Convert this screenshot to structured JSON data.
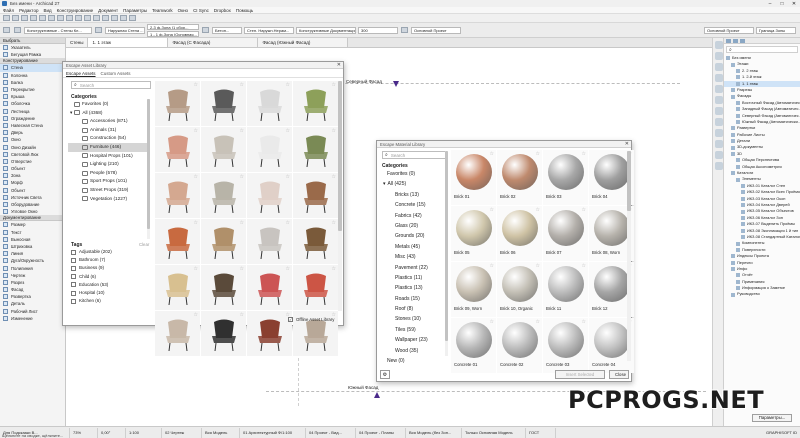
{
  "app": {
    "window_title": "Без имени - Archicad 27",
    "menu": [
      "Файл",
      "Редактор",
      "Вид",
      "Конструирование",
      "Документ",
      "Параметры",
      "Teamwork",
      "Окно",
      "CI Sync",
      "Dropbox",
      "Помощь"
    ]
  },
  "toolbar": {
    "field1": "Конструктивные - Стены Кл...",
    "field2": "Наружная Стена ...",
    "field3": "2-3 ф-Зона (1 сбор...",
    "field4": "1 - 1 ф-Зона (Основная...",
    "field5": "Бетон...",
    "field6": "Стен. Наружн.Нерам...",
    "field7": "Конструктивные Документации...",
    "field8": "300",
    "field9": "Основной Проект",
    "field10": "Основной Проект",
    "field11": "Граница Зоны"
  },
  "view_tabs": [
    "Стены",
    "1. 1 этаж",
    "Фасад (С Фасада)",
    "Фасад (Южный Фасад)"
  ],
  "left_panel": {
    "sections": [
      {
        "title": "Выбрать",
        "items": [
          "Указатель",
          "Бегущая Рамка"
        ]
      },
      {
        "title": "Конструирование",
        "items": [
          "Стена",
          "Колонна",
          "Балка",
          "Перекрытие",
          "Крыша",
          "Оболочка",
          "Лестница",
          "Ограждение",
          "Навесная Стена",
          "Дверь",
          "Окно",
          "Окно Дизайн",
          "Световой Люк",
          "Отверстие",
          "Объект",
          "Зона",
          "Морф",
          "Объект",
          "Источник Света",
          "Оборудование",
          "Угловое Окно"
        ]
      },
      {
        "title": "Документирование",
        "items": [
          "Размер",
          "Текст",
          "Выносная",
          "Штриховка",
          "Линия",
          "Дуга/Окружность",
          "Полилиния",
          "Чертеж",
          "Разрез",
          "Фасад",
          "Развертка",
          "Деталь",
          "Рабочий Лист",
          "Изменение"
        ]
      }
    ]
  },
  "canvas": {
    "label_top": "Северный Фасад",
    "label_bottom": "Южный Фасад"
  },
  "object_library": {
    "title": "Escape Asset Library",
    "tabs": [
      "Escape Assets",
      "Custom Assets"
    ],
    "search_placeholder": "Search",
    "categories_header": "Categories",
    "categories": [
      {
        "name": "Favorites (0)",
        "indent": 1
      },
      {
        "name": "All (4368)",
        "indent": 1
      },
      {
        "name": "Accessories (871)",
        "indent": 2
      },
      {
        "name": "Animals (31)",
        "indent": 2
      },
      {
        "name": "Construction (54)",
        "indent": 2
      },
      {
        "name": "Furniture (446)",
        "indent": 2,
        "selected": true
      },
      {
        "name": "Hospital Props (101)",
        "indent": 2
      },
      {
        "name": "Lighting (210)",
        "indent": 2
      },
      {
        "name": "People (578)",
        "indent": 2
      },
      {
        "name": "Sport Props (101)",
        "indent": 2
      },
      {
        "name": "Street Props (319)",
        "indent": 2
      },
      {
        "name": "Vegetation (1227)",
        "indent": 2
      }
    ],
    "tags_header": "Tags",
    "tags_clear": "Clear",
    "tags": [
      "Adjustable (202)",
      "Bathroom (7)",
      "Business (9)",
      "Child (6)",
      "Education (53)",
      "Hospital (10)",
      "Kitchen (6)"
    ],
    "offline_label": "Offline Asset Library",
    "thumb_colors": [
      "#b59b86",
      "#5a5a5a",
      "#d9d9d9",
      "#8da05a",
      "#d69a86",
      "#c8c2b8",
      "#eaeaea",
      "#7a8a55",
      "#d4a890",
      "#b8b4a8",
      "#e0d0c8",
      "#9a6a4a",
      "#c86a40",
      "#b0906a",
      "#c8c4c0",
      "#7a5a3a",
      "#d8c090",
      "#5a4a3a",
      "#cc5555",
      "#cc5545",
      "#c8b8a8",
      "#303030",
      "#8a4030",
      "#b8a898"
    ]
  },
  "material_library": {
    "title": "Escape Material Library",
    "search_placeholder": "Search",
    "categories_header": "Categories",
    "categories": [
      "Favorites (0)",
      "All (425)",
      "Bricks (13)",
      "Concrete (15)",
      "Fabrics (42)",
      "Glass (20)",
      "Grounds (20)",
      "Metals (45)",
      "Misc (43)",
      "Pavement (22)",
      "Plastics (11)",
      "Plastics (13)",
      "Roads (15)",
      "Roof (8)",
      "Stones (10)",
      "Tiles (59)",
      "Wallpaper (23)",
      "Wood (35)",
      "New (0)"
    ],
    "materials": [
      {
        "label": "Brick 01",
        "color": "#c98768"
      },
      {
        "label": "Brick 02",
        "color": "#bf8a6e"
      },
      {
        "label": "Brick 03",
        "color": "#a8a8a8"
      },
      {
        "label": "Brick 04",
        "color": "#9f9f9f"
      },
      {
        "label": "Brick 05",
        "color": "#d0c7ac"
      },
      {
        "label": "Brick 06",
        "color": "#cfc3a5"
      },
      {
        "label": "Brick 07",
        "color": "#b4b0ab"
      },
      {
        "label": "Brick 08, Worn",
        "color": "#b7b3ac"
      },
      {
        "label": "Brick 09, Worn",
        "color": "#c9c1b3"
      },
      {
        "label": "Brick 10, Organic",
        "color": "#c4c0b6"
      },
      {
        "label": "Brick 11",
        "color": "#bdbdbd"
      },
      {
        "label": "Brick 12",
        "color": "#a6a6a6"
      },
      {
        "label": "Concrete 01",
        "color": "#b7b7b7"
      },
      {
        "label": "Concrete 02",
        "color": "#bdbdbd"
      },
      {
        "label": "Concrete 03",
        "color": "#bdbdbd"
      },
      {
        "label": "Concrete 04",
        "color": "#c3c3c3"
      }
    ],
    "insert_label": "Insert Selected",
    "close_label": "Close"
  },
  "navigator": {
    "items": [
      {
        "label": "Без имени",
        "level": 0
      },
      {
        "label": "Этажи",
        "level": 1
      },
      {
        "label": "2. 2 этаж",
        "level": 2
      },
      {
        "label": "1. 2-й этаж",
        "level": 2
      },
      {
        "label": "1. 1 этаж",
        "level": 2,
        "selected": true
      },
      {
        "label": "Разрезы",
        "level": 1
      },
      {
        "label": "Фасады",
        "level": 1
      },
      {
        "label": "Восточный Фасад (Автоматичес...",
        "level": 2
      },
      {
        "label": "Западный Фасад (Автоматичес...",
        "level": 2
      },
      {
        "label": "Северный Фасад (Автоматичес...",
        "level": 2
      },
      {
        "label": "Южный Фасад (Автоматически...",
        "level": 2
      },
      {
        "label": "Развертки",
        "level": 1
      },
      {
        "label": "Рабочие Листы",
        "level": 1
      },
      {
        "label": "Детали",
        "level": 1
      },
      {
        "label": "3D-документы",
        "level": 1
      },
      {
        "label": "3D",
        "level": 1
      },
      {
        "label": "Общая Перспектива",
        "level": 2
      },
      {
        "label": "Общая Аксонометрия",
        "level": 2
      },
      {
        "label": "Каталоги",
        "level": 1
      },
      {
        "label": "Элементы",
        "level": 2
      },
      {
        "label": "ИКЗ-01 Каталог Стен",
        "level": 3
      },
      {
        "label": "ИКЗ-02 Каталог Всех Проёмов",
        "level": 3
      },
      {
        "label": "ИКЗ-03 Каталог Окон",
        "level": 3
      },
      {
        "label": "ИКЗ-04 Каталог Дверей",
        "level": 3
      },
      {
        "label": "ИКЗ-05 Каталог Объектов",
        "level": 3
      },
      {
        "label": "ИКЗ-06 Каталог Зон",
        "level": 3
      },
      {
        "label": "ИКЗ-07 Выделить Проёмы",
        "level": 3
      },
      {
        "label": "ИКЗ-08 Экспликация 1 й тип",
        "level": 3
      },
      {
        "label": "ИКЗ-08 Стандартный Каталог Ст...",
        "level": 3
      },
      {
        "label": "Компоненты",
        "level": 2
      },
      {
        "label": "Поверхности",
        "level": 2
      },
      {
        "label": "Индексы Проекта",
        "level": 1
      },
      {
        "label": "Перечни",
        "level": 1
      },
      {
        "label": "Инфо",
        "level": 1
      },
      {
        "label": "Отчёт",
        "level": 2
      },
      {
        "label": "Примечания",
        "level": 2
      },
      {
        "label": "Информация о Заметке",
        "level": 2
      },
      {
        "label": "Руководство",
        "level": 1
      }
    ],
    "footer_button": "Параметры..."
  },
  "statusbar": {
    "left": "Для Подсказки В...",
    "fields": [
      "73%",
      "0,00°",
      "1:100",
      "02 Чертеж",
      "Вся Модель",
      "01 Архитектурный Ф/1:100",
      "04 Проект - Вид...",
      "04 Проект - Планы",
      "Вся Модель (без Зон...",
      "Только Основная Модель",
      "ГОСТ"
    ],
    "hint": "Щёлкните на сводке, щёлкните...",
    "right": "GRAPHISOFT ID"
  },
  "watermark": "PCPROGS.NET"
}
